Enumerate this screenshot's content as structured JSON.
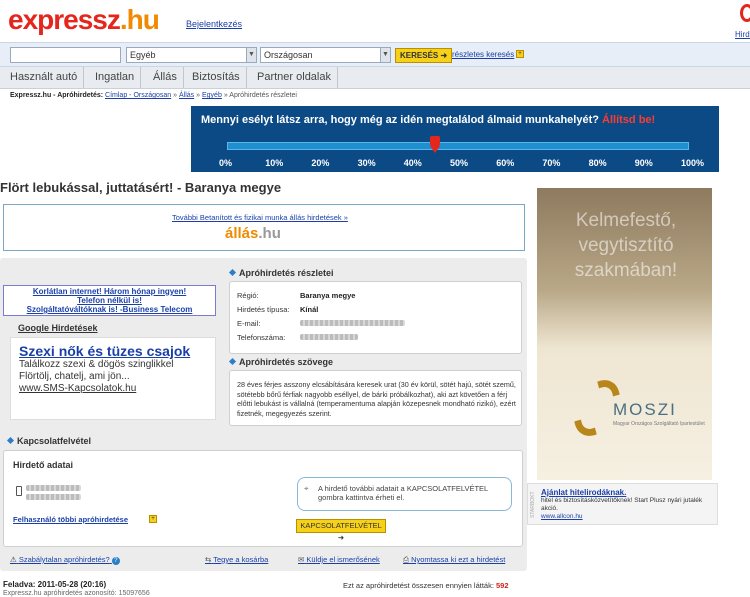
{
  "header": {
    "logo_ex": "ex",
    "logo_pressz": "pressz",
    "logo_hu": ".hu",
    "login": "Bejelentkezés",
    "topright": "Hirde"
  },
  "search": {
    "query": "",
    "category": "Egyéb",
    "region": "Országosan",
    "button": "KERESÉS",
    "advanced": "részletes keresés"
  },
  "nav": [
    "Használt autó",
    "Ingatlan",
    "Állás",
    "Biztosítás",
    "Partner oldalak"
  ],
  "breadcrumb": {
    "prefix": "Expressz.hu - Apróhirdetés:",
    "items": [
      "Címlap - Országosan",
      "Állás",
      "Egyéb"
    ],
    "current": "Apróhirdetés részletei",
    "sep": "»"
  },
  "banner": {
    "text_white": "Mennyi esélyt látsz arra, hogy még az idén  megtalálod álmaid munkahelyét?",
    "text_red": "Állítsd be!",
    "ticks": [
      "0%",
      "10%",
      "20%",
      "30%",
      "40%",
      "50%",
      "60%",
      "70%",
      "80%",
      "90%",
      "100%"
    ],
    "marker_value": 45,
    "colors": {
      "bg": "#0c4a86",
      "accent": "#e4261c"
    }
  },
  "page_title": "Flört lebukással, juttatásért! - Baranya megye",
  "top_ad": {
    "link": "További Betanított és fizikai munka állás hirdetések »",
    "logo_a": "állás",
    "logo_b": ".hu"
  },
  "promo": {
    "line1": "Korlátlan internet! Három hónap ingyen!",
    "line2": "Telefon nélkül is!",
    "line3": "Szolgáltatóváltóknak is! -Business Telecom"
  },
  "google": {
    "heading": "Google Hirdetések",
    "title": "Szexi nők és tüzes csajok",
    "desc": "Találkozz szexi & dögös szinglikkel Flörtölj, chatelj, ami jön...",
    "url": "www.SMS-Kapcsolatok.hu"
  },
  "details": {
    "heading": "Apróhirdetés részletei",
    "rows": [
      {
        "label": "Régió:",
        "value": "Baranya megye"
      },
      {
        "label": "Hirdetés típusa:",
        "value": "Kínál"
      },
      {
        "label": "E-mail:",
        "value": ""
      },
      {
        "label": "Telefonszáma:",
        "value": ""
      }
    ]
  },
  "text": {
    "heading": "Apróhirdetés szövege",
    "body": "28 éves férjes asszony elcsábítására keresek urat (30 év körül, sötét hajú, sötét szemű, sötétebb bőrű férfiak nagyobb eséllyel, de bárki próbálkozhat), aki azt követően a férj előtti lebukást is vállalná (temperamentuma alapján közepesnek mondható rizikó), ezért fizetnék, megegyezés szerint."
  },
  "contact": {
    "heading": "Kapcsolatfelvétel",
    "sub": "Hirdető adatai",
    "other_ads": "Felhasználó többi apróhirdetése",
    "tip": "A hirdető további adatait a KAPCSOLATFELVÉTEL gombra kattintva érheti el.",
    "button": "KAPCSOLATFELVÉTEL"
  },
  "actions": {
    "report": "Szabálytalan apróhirdetés?",
    "cart": "Tegye a kosárba",
    "send": "Küldje el ismerősének",
    "print": "Nyomtassa ki ezt a hirdetést"
  },
  "footer": {
    "date": "Feladva: 2011-05-28 (20:16)",
    "id_label": "Expressz.hu apróhirdetés azonosító: 15097656",
    "counter_label": "Ezt az apróhirdetést összesen ennyien látták:",
    "counter_value": "592"
  },
  "moszi": {
    "headline": "Kelmefestő, vegytisztító szakmában!",
    "name": "MOSZI",
    "sub": "Magyar Országos Szolgáltató Ipartestület"
  },
  "sponsor": {
    "label": "STARBOKT",
    "title": "Ajánlat hitelirodáknak.",
    "desc": "hitel és biztosításközvetítőknek! Start Plusz nyári jutalék akció.",
    "url": "www.allcon.hu"
  }
}
